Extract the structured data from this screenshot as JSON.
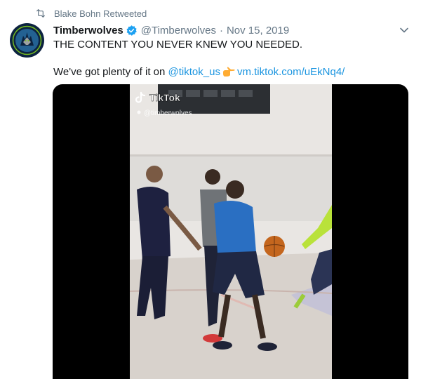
{
  "retweet": {
    "icon": "retweet-icon",
    "text": "Blake Bohn Retweeted"
  },
  "author": {
    "name": "Timberwolves",
    "verified_icon": "verified-badge-icon",
    "handle": "@Timberwolves",
    "separator": "·",
    "date": "Nov 15, 2019",
    "avatar": "timberwolves-logo"
  },
  "menu_icon": "chevron-down-icon",
  "body": {
    "line1": "THE CONTENT YOU NEVER KNEW YOU NEEDED.",
    "line2_prefix": "We've got plenty of it on",
    "mention": "@tiktok_us",
    "emoji": "pointing-right-emoji",
    "url": "vm.tiktok.com/uEkNq4/"
  },
  "media": {
    "type": "video",
    "overlay_brand": "TikTok",
    "overlay_handle": "@timberwolves"
  },
  "colors": {
    "link": "#1b95e0",
    "secondary_text": "#657786",
    "verified": "#1da1f2"
  }
}
